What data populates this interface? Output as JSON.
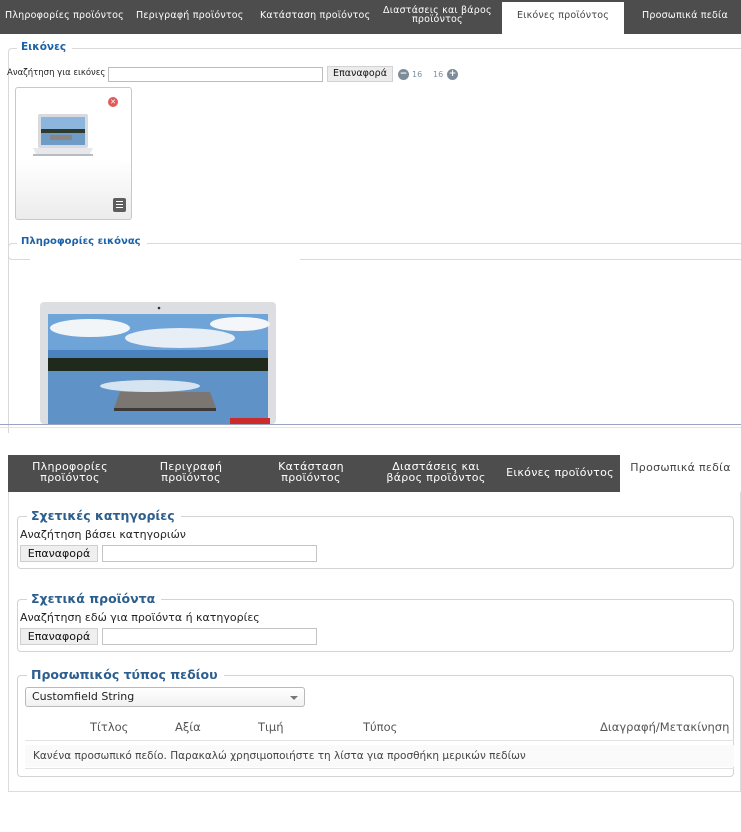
{
  "top_panel": {
    "tabs": [
      {
        "label": "Πληροφορίες προϊόντος"
      },
      {
        "label": "Περιγραφή προϊόντος"
      },
      {
        "label": "Κατάσταση προϊόντος"
      },
      {
        "label_line1": "Διαστάσεις και βάρος",
        "label_line2": "προϊόντος"
      },
      {
        "label": "Εικόνες προϊόντος",
        "active": true
      },
      {
        "label": "Προσωπικά πεδία"
      }
    ],
    "images_section": {
      "legend": "Εικόνες",
      "search_label": "Αναζήτηση για εικόνες",
      "search_value": "",
      "reset_label": "Επαναφορά",
      "pager_left": "16",
      "pager_right": "16",
      "minus_symbol": "−",
      "plus_symbol": "+"
    },
    "image_info_section": {
      "legend": "Πληροφορίες εικόνας"
    }
  },
  "bottom_panel": {
    "tabs": [
      {
        "label_line1": "Πληροφορίες",
        "label_line2": "προϊόντος"
      },
      {
        "label_line1": "Περιγραφή",
        "label_line2": "προϊόντος"
      },
      {
        "label_line1": "Κατάσταση",
        "label_line2": "προϊόντος"
      },
      {
        "label_line1": "Διαστάσεις και",
        "label_line2": "βάρος προϊόντος"
      },
      {
        "label": "Εικόνες προϊόντος"
      },
      {
        "label": "Προσωπικά πεδία",
        "active": true
      }
    ],
    "related_categories": {
      "legend": "Σχετικές κατηγορίες",
      "search_label": "Αναζήτηση βάσει κατηγοριών",
      "reset_label": "Επαναφορά",
      "search_value": ""
    },
    "related_products": {
      "legend": "Σχετικά προϊόντα",
      "search_label": "Αναζήτηση εδώ για προϊόντα ή κατηγορίες",
      "reset_label": "Επαναφορά",
      "search_value": ""
    },
    "custom_field_type": {
      "legend": "Προσωπικός τύπος πεδίου",
      "selected_option": "Customfield String",
      "columns": [
        "Τίτλος",
        "Αξία",
        "Τιμή",
        "Τύπος",
        "Διαγραφή/Μετακίνηση"
      ],
      "empty_message": "Κανένα προσωπικό πεδίο. Παρακαλώ χρησιμοποιήστε τη λίστα για προσθήκη μερικών πεδίων"
    }
  },
  "colors": {
    "tab_bar": "#4d4d4d",
    "legend_blue": "#2c5e8e",
    "legend_blue_top": "#1c62a8",
    "delete_red": "#e05a5a"
  },
  "icons": [
    "delete-icon",
    "edit-image-icon",
    "minus-circle-icon",
    "plus-circle-icon",
    "dropdown-arrow-icon"
  ]
}
